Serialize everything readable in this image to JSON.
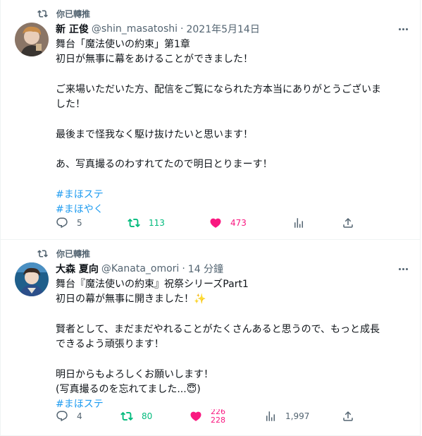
{
  "colors": {
    "accent": "#1d9bf0",
    "retweet_green": "#00ba7c",
    "like_pink": "#f91880",
    "secondary_text": "#536471"
  },
  "tweets": [
    {
      "retweet_label": "你已轉推",
      "display_name": "新 正俊",
      "handle": "@shin_masatoshi",
      "separator": "·",
      "time": "2021年5月14日",
      "lines": [
        "舞台「魔法使いの約束」第1章",
        "初日が無事に幕をあけることができました！",
        "",
        "ご来場いただいた方、配信をご覧になられた方本当にありがとうございま",
        "した！",
        "",
        "最後まで怪我なく駆け抜けたいと思います！",
        "",
        "あ、写真撮るのわすれてたので明日とりまーす！",
        ""
      ],
      "hashtags": [
        "#まほステ",
        "#まほやく"
      ],
      "replies": "5",
      "retweets": "113",
      "likes": "473",
      "icons": [
        "retweet-icon",
        "reply-icon",
        "retweet-icon",
        "heart-filled-icon",
        "analytics-icon",
        "share-icon",
        "more-icon"
      ]
    },
    {
      "retweet_label": "你已轉推",
      "display_name": "大森 夏向",
      "handle": "@Kanata_omori",
      "separator": "·",
      "time": "14 分鐘",
      "lines": [
        "舞台『魔法使いの約束』祝祭シリーズPart1",
        "初日の幕が無事に開きました！✨",
        "",
        "賢者として、まだまだやれることがたくさんあると思うので、もっと成長",
        "できるよう頑張ります！",
        "",
        "明日からもよろしくお願いします！",
        "(写真撮るのを忘れてました...😇)"
      ],
      "hashtags": [
        "#まほステ"
      ],
      "replies": "4",
      "retweets": "80",
      "likes_top": "226",
      "likes_bottom": "228",
      "views": "1,997",
      "icons": [
        "retweet-icon",
        "reply-icon",
        "retweet-icon",
        "heart-filled-icon",
        "analytics-icon",
        "share-icon",
        "more-icon"
      ]
    }
  ]
}
